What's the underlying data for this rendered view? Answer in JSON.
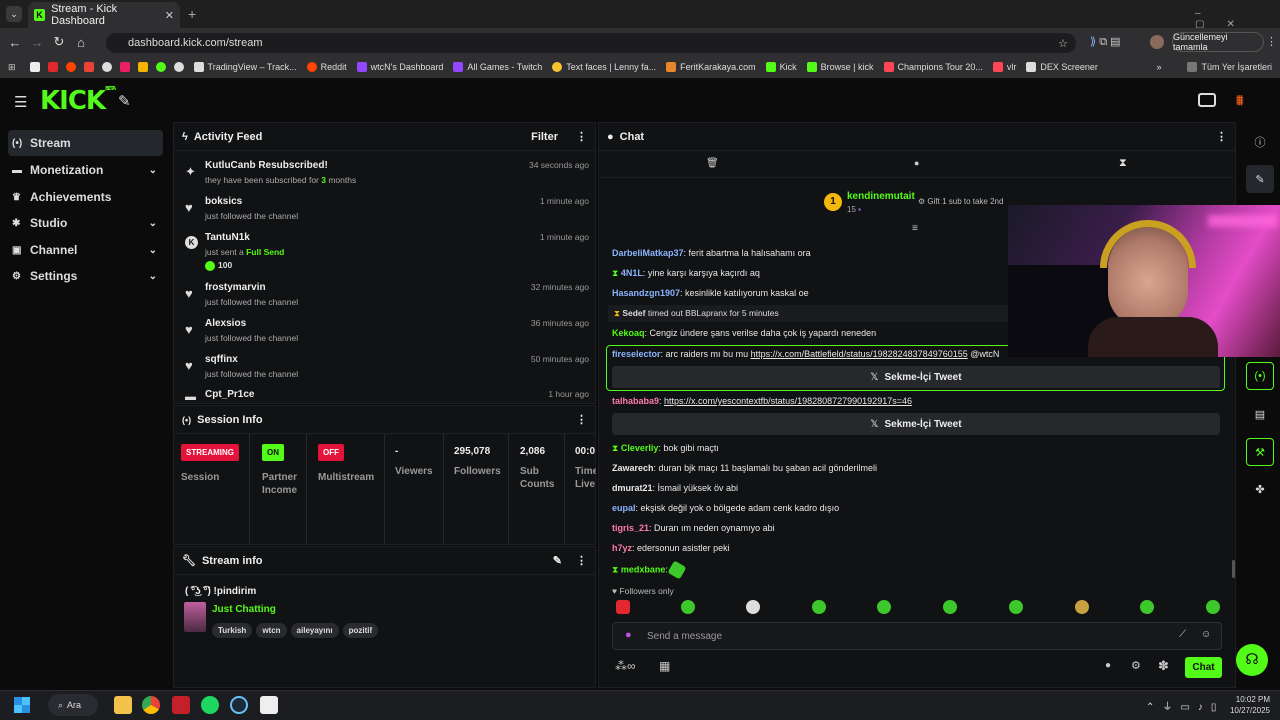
{
  "browser": {
    "tab_title": "Stream - Kick Dashboard",
    "url": "dashboard.kick.com/stream",
    "update_label": "Güncellemeyi tamamla",
    "bookmarks": [
      "TradingView – Track...",
      "Reddit",
      "wtcN's Dashboard",
      "All Games - Twitch",
      "Text faces | Lenny fa...",
      "FeritKarakaya.com",
      "Kick",
      "Browse | kick",
      "Champions Tour 20...",
      "vlr",
      "DEX Screener"
    ],
    "all_bookmarks": "Tüm Yer İşaretleri"
  },
  "kick": {
    "logo": "KICK",
    "beta": "BETA"
  },
  "sidebar": {
    "items": [
      {
        "label": "Stream",
        "icon": "broadcast-icon",
        "active": true
      },
      {
        "label": "Monetization",
        "icon": "money-icon",
        "expandable": true
      },
      {
        "label": "Achievements",
        "icon": "trophy-icon"
      },
      {
        "label": "Studio",
        "icon": "studio-icon",
        "expandable": true
      },
      {
        "label": "Channel",
        "icon": "channel-icon",
        "expandable": true
      },
      {
        "label": "Settings",
        "icon": "gear-icon",
        "expandable": true
      }
    ]
  },
  "activity": {
    "title": "Activity Feed",
    "filter": "Filter",
    "items": [
      {
        "name": "KutluCanb Resubscribed!",
        "sub_pre": "they have been subscribed for ",
        "sub_num": "3",
        "sub_post": " months",
        "time": "34 seconds ago",
        "icon": "sparkle-icon"
      },
      {
        "name": "boksics",
        "sub_pre": "just followed the channel",
        "time": "1 minute ago",
        "icon": "heart-icon"
      },
      {
        "name": "TantuN1k",
        "sub_pre": "just sent a ",
        "sub_num": "Full Send",
        "extra": "100",
        "time": "1 minute ago",
        "icon": "kick-coin-icon"
      },
      {
        "name": "frostymarvin",
        "sub_pre": "just followed the channel",
        "time": "32 minutes ago",
        "icon": "heart-icon"
      },
      {
        "name": "Alexsios",
        "sub_pre": "just followed the channel",
        "time": "36 minutes ago",
        "icon": "heart-icon"
      },
      {
        "name": "sqffinx",
        "sub_pre": "just followed the channel",
        "time": "50 minutes ago",
        "icon": "heart-icon"
      },
      {
        "name": "Cpt_Pr1ce",
        "time": "1 hour ago",
        "icon": "gift-icon"
      }
    ]
  },
  "session": {
    "title": "Session Info",
    "cols": [
      {
        "badge": "STREAMING",
        "badge_color": "#e4133b",
        "label": "Session"
      },
      {
        "badge": "ON",
        "badge_color": "#53fc18",
        "label": "Partner Income"
      },
      {
        "badge": "OFF",
        "badge_color": "#e4133b",
        "label": "Multistream"
      },
      {
        "value": "-",
        "label": "Viewers"
      },
      {
        "value": "295,078",
        "label": "Followers"
      },
      {
        "value": "2,086",
        "label": "Sub Counts"
      },
      {
        "value": "00:0",
        "label": "Time Live"
      }
    ]
  },
  "streaminfo": {
    "title": "Stream info",
    "stream_title": "( ͡°͜ʖ ͡°) !pindirim",
    "category": "Just Chatting",
    "tags": [
      "Turkish",
      "wtcn",
      "aileyayını",
      "pozitif"
    ]
  },
  "chat": {
    "title": "Chat",
    "leader_name": "kendinemutait",
    "leader_count": "15",
    "leader_rank": "1",
    "gift_label": "Gift 1 sub to take 2nd",
    "messages": [
      {
        "user": "DarbeliMatkap37",
        "color": "#8ab4ff",
        "text": "ferit abartma la halısahamı ora"
      },
      {
        "user": "4N1L",
        "color": "#8ab4ff",
        "text": "yine karşı karşıya kaçırdı aq",
        "badge": true
      },
      {
        "user": "Hasandzgn1907",
        "color": "#8ab4ff",
        "text": "kesinlikle katılıyorum kaskal oe"
      },
      {
        "user": "Sedef",
        "color": "#e8e8e8",
        "text": " timed out BBLapranx for 5 minutes",
        "system": true
      },
      {
        "user": "Kekoaq",
        "color": "#53fc18",
        "text": "Cengiz ündere şans verilse daha çok iş yapardı neneden"
      },
      {
        "user": "fireselector",
        "color": "#8ab4ff",
        "text": "arc raiders mı bu mu ",
        "link": "https://x.com/Battlefield/status/1982824837849760155",
        "after": " @wtcN"
      },
      {
        "user": "talhababa9",
        "color": "#ff7aa8",
        "text": "",
        "link": "https://x.com/yescontextfb/status/1982808727990192917s=46"
      },
      {
        "user": "Cleverliy",
        "color": "#53fc18",
        "text": "bok gibi maçtı",
        "badge": true
      },
      {
        "user": "Zawarech",
        "color": "#e8e8e8",
        "text": "duran bjk maçı 11 başlamalı bu şaban acil gönderilmeli"
      },
      {
        "user": "dmurat21",
        "color": "#e8e8e8",
        "text": "İsmail yüksek öv abi"
      },
      {
        "user": "eupal",
        "color": "#8ab4ff",
        "text": "ekşisk değil yok o bölgede adam cenk kadro dışıo"
      },
      {
        "user": "tigris_21",
        "color": "#ff7aa8",
        "text": "Duran ım neden oynamıyo abi"
      },
      {
        "user": "h7yz",
        "color": "#ff7aa8",
        "text": "edersonun asistler peki"
      },
      {
        "user": "medxbane",
        "color": "#53fc18",
        "text": "",
        "badge": true
      }
    ],
    "tweet_label": "Sekme-İçi Tweet",
    "followers_only": "Followers only",
    "placeholder": "Send a message",
    "send_label": "Chat"
  },
  "taskbar": {
    "search": "Ara",
    "time": "10:02 PM",
    "date": "10/27/2025"
  }
}
